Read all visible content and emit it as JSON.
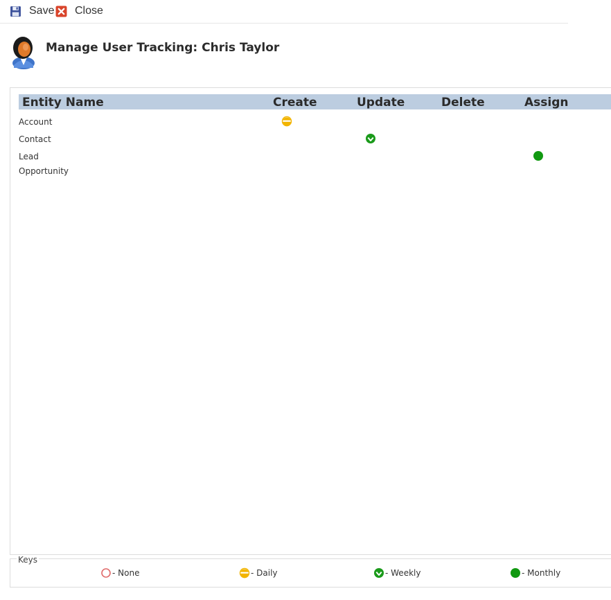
{
  "toolbar": {
    "save_label": "Save",
    "close_label": "Close"
  },
  "header": {
    "title": "Manage User Tracking: Chris Taylor"
  },
  "grid": {
    "columns": [
      "Entity Name",
      "Create",
      "Update",
      "Delete",
      "Assign"
    ],
    "rows": [
      {
        "entity": "Account",
        "create": "daily",
        "update": null,
        "delete": null,
        "assign": null
      },
      {
        "entity": "Contact",
        "create": null,
        "update": "weekly",
        "delete": null,
        "assign": null
      },
      {
        "entity": "Lead",
        "create": null,
        "update": null,
        "delete": null,
        "assign": "monthly"
      },
      {
        "entity": "Opportunity",
        "create": null,
        "update": null,
        "delete": null,
        "assign": null
      }
    ]
  },
  "keys": {
    "label": "Keys",
    "items": [
      {
        "id": "none",
        "label": "- None"
      },
      {
        "id": "daily",
        "label": "- Daily"
      },
      {
        "id": "weekly",
        "label": "- Weekly"
      },
      {
        "id": "monthly",
        "label": "- Monthly"
      }
    ]
  },
  "colors": {
    "header_bg": "#bccde0",
    "none": "#e06a6a",
    "daily": "#f2b400",
    "weekly": "#1a9a1a",
    "monthly": "#119911"
  }
}
